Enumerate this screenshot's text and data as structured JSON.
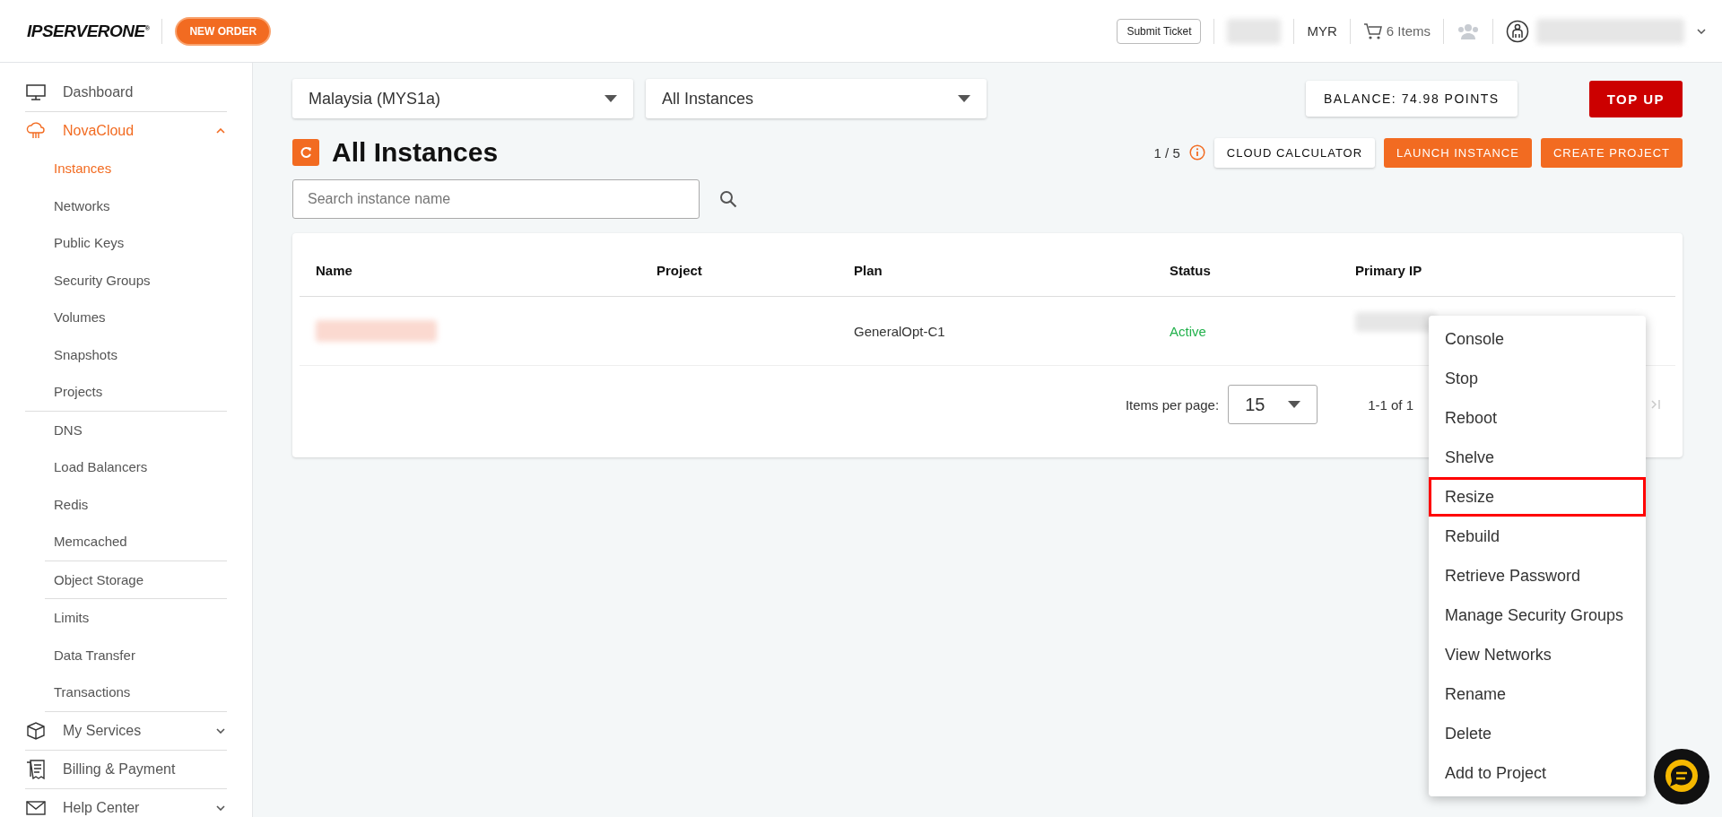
{
  "header": {
    "logo": "IPSERVERONE",
    "logo_mark": "®",
    "new_order": "NEW ORDER",
    "submit_ticket": "Submit Ticket",
    "currency": "MYR",
    "cart": "6 Items"
  },
  "sidebar": {
    "items": [
      {
        "label": "Dashboard",
        "selected": false
      },
      {
        "label": "NovaCloud",
        "expanded": true,
        "selected": true,
        "groups": [
          {
            "children": [
              {
                "label": "Instances",
                "selected": true
              },
              {
                "label": "Networks",
                "selected": false
              },
              {
                "label": "Public Keys",
                "selected": false
              },
              {
                "label": "Security Groups",
                "selected": false
              },
              {
                "label": "Volumes",
                "selected": false
              },
              {
                "label": "Snapshots",
                "selected": false
              },
              {
                "label": "Projects",
                "selected": false
              }
            ]
          },
          {
            "children": [
              {
                "label": "DNS",
                "selected": false
              },
              {
                "label": "Load Balancers",
                "selected": false
              },
              {
                "label": "Redis",
                "selected": false
              },
              {
                "label": "Memcached",
                "selected": false
              }
            ]
          },
          {
            "children": [
              {
                "label": "Object Storage",
                "selected": false
              }
            ]
          },
          {
            "children": [
              {
                "label": "Limits",
                "selected": false
              },
              {
                "label": "Data Transfer",
                "selected": false
              },
              {
                "label": "Transactions",
                "selected": false
              }
            ]
          }
        ]
      },
      {
        "label": "My Services",
        "expanded": false,
        "selected": false
      },
      {
        "label": "Billing & Payment",
        "selected": false
      },
      {
        "label": "Help Center",
        "expanded": false,
        "selected": false
      }
    ]
  },
  "filters": {
    "region": "Malaysia (MYS1a)",
    "scope": "All Instances"
  },
  "balance": "BALANCE: 74.98 POINTS",
  "top_up": "TOP UP",
  "title": "All Instances",
  "quota": "1 / 5",
  "actions": [
    "CLOUD CALCULATOR",
    "LAUNCH INSTANCE",
    "CREATE PROJECT"
  ],
  "search": {
    "placeholder": "Search instance name"
  },
  "table": {
    "columns": [
      "Name",
      "Project",
      "Plan",
      "Status",
      "Primary IP"
    ],
    "rows": [
      {
        "plan": "GeneralOpt-C1",
        "status": "Active"
      }
    ]
  },
  "pagination": {
    "label": "Items per page:",
    "per_page": "15",
    "range": "1-1 of 1"
  },
  "menu": {
    "items": [
      {
        "label": "Console",
        "highlighted": false
      },
      {
        "label": "Stop",
        "highlighted": false
      },
      {
        "label": "Reboot",
        "highlighted": false
      },
      {
        "label": "Shelve",
        "highlighted": false
      },
      {
        "label": "Resize",
        "highlighted": true
      },
      {
        "label": "Rebuild",
        "highlighted": false
      },
      {
        "label": "Retrieve Password",
        "highlighted": false
      },
      {
        "label": "Manage Security Groups",
        "highlighted": false
      },
      {
        "label": "View Networks",
        "highlighted": false
      },
      {
        "label": "Rename",
        "highlighted": false
      },
      {
        "label": "Delete",
        "highlighted": false
      },
      {
        "label": "Add to Project",
        "highlighted": false
      }
    ]
  }
}
